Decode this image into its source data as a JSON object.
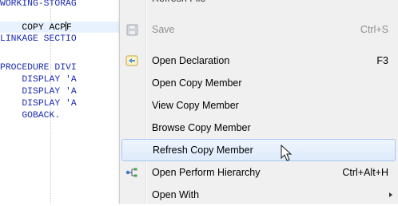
{
  "editor": {
    "lines": [
      {
        "text": "WORKING-STORAG"
      },
      {
        "indent": "    ",
        "before_cursor": "COPY ACP",
        "after_cursor": "F"
      },
      {
        "text": "LINKAGE SECTIO"
      },
      {
        "text": ""
      },
      {
        "text": "PROCEDURE DIVI"
      },
      {
        "text": "    DISPLAY 'A"
      },
      {
        "text": "    DISPLAY 'A"
      },
      {
        "text": "    DISPLAY 'A"
      },
      {
        "text": "    GOBACK."
      }
    ]
  },
  "context_menu": {
    "cut_item": "Refresh File",
    "items": [
      {
        "label": "Save",
        "accelerator": "Ctrl+S",
        "icon": "save-icon",
        "disabled": true
      },
      {
        "label": "Open Declaration",
        "accelerator": "F3",
        "icon": "open-declaration-icon"
      },
      {
        "label": "Open Copy Member"
      },
      {
        "label": "View Copy Member"
      },
      {
        "label": "Browse Copy Member"
      },
      {
        "label": "Refresh Copy Member",
        "highlighted": true
      },
      {
        "label": "Open Perform Hierarchy",
        "accelerator": "Ctrl+Alt+H",
        "icon": "hierarchy-icon"
      },
      {
        "label": "Open With",
        "submenu": true
      }
    ]
  }
}
